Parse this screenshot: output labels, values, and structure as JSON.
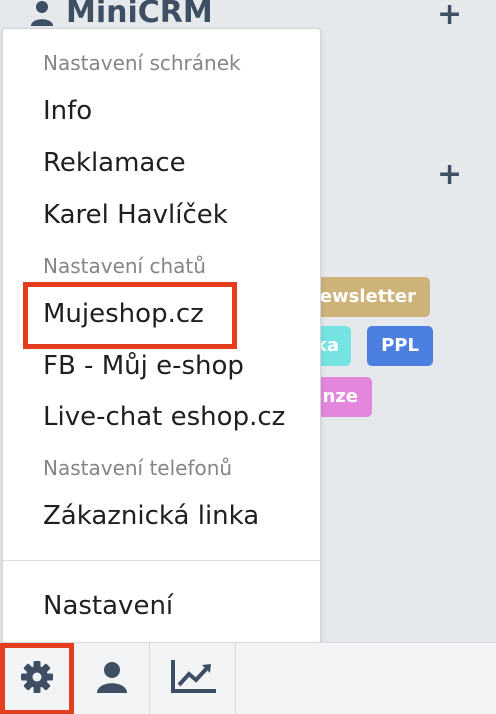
{
  "header": {
    "title": "MiniCRM"
  },
  "tags": {
    "newsletter": "ewsletter",
    "ka": "ka",
    "ppl": "PPL",
    "nze": "nze"
  },
  "menu": {
    "sections": {
      "mailboxes": "Nastavení schránek",
      "chats": "Nastavení chatů",
      "phones": "Nastavení telefonů"
    },
    "items": {
      "info": "Info",
      "reklamace": "Reklamace",
      "karel": "Karel Havlíček",
      "mujeshop": "Mujeshop.cz",
      "fb": "FB - Můj e-shop",
      "livechat": "Live-chat eshop.cz",
      "zakaznicka": "Zákaznická linka",
      "nastaveni": "Nastavení"
    }
  },
  "colors": {
    "accent": "#3e4f63",
    "highlight": "#e43e1e",
    "tag_newsletter": "#cdb37a",
    "tag_ka": "#76e3e3",
    "tag_ppl": "#4d7fe0",
    "tag_nze": "#e487dc"
  },
  "icons": {
    "header_user": "user-icon",
    "settings": "gear-icon",
    "user": "user-icon",
    "stats": "chart-icon"
  }
}
